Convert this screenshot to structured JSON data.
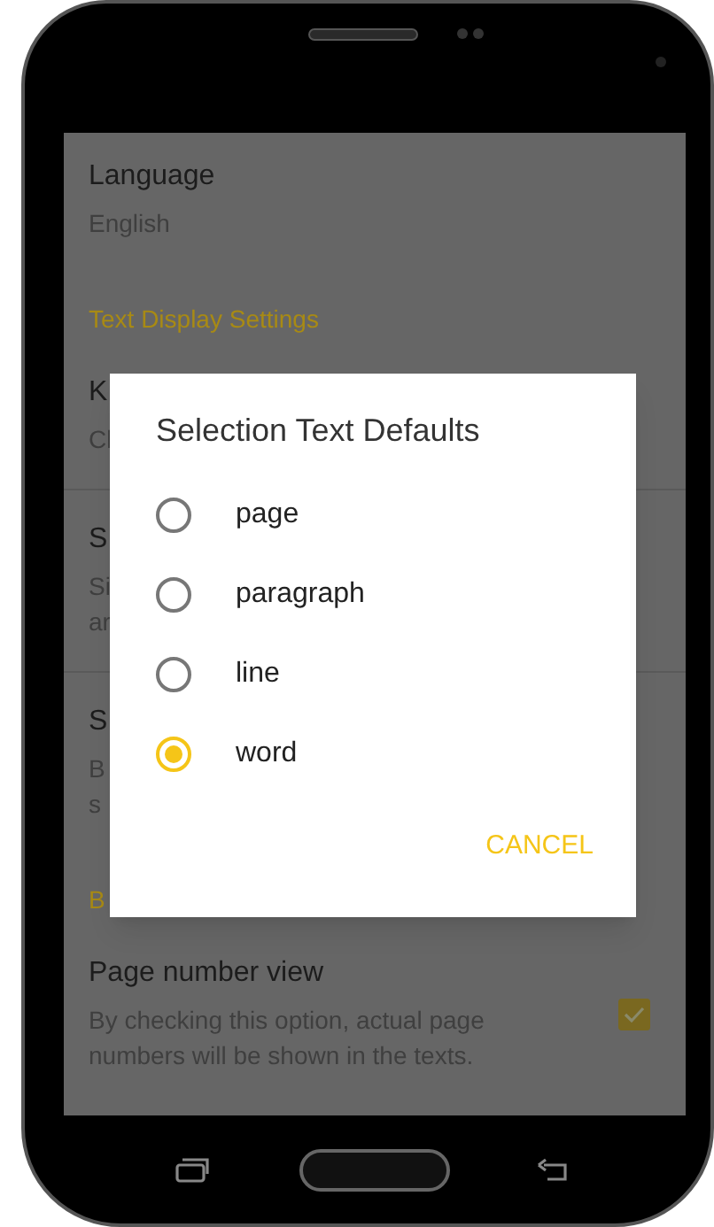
{
  "settings": [
    {
      "kind": "item",
      "title": "Language",
      "subtitle": [
        "English"
      ]
    },
    {
      "kind": "header",
      "title": "Text Display Settings"
    },
    {
      "kind": "item",
      "title": "K",
      "subtitle": [
        "Cl"
      ]
    },
    {
      "kind": "item",
      "title": "S",
      "subtitle": [
        "Si",
        "ar"
      ]
    },
    {
      "kind": "item",
      "title": "S",
      "subtitle": [
        "B",
        "s"
      ]
    },
    {
      "kind": "header",
      "title": "B"
    },
    {
      "kind": "check",
      "title": "Page number view",
      "subtitle": [
        "By checking this option, actual page",
        "numbers will be shown in the texts."
      ],
      "checked": true
    }
  ],
  "dialog": {
    "title": "Selection Text Defaults",
    "options": [
      {
        "label": "page",
        "selected": false
      },
      {
        "label": "paragraph",
        "selected": false
      },
      {
        "label": "line",
        "selected": false
      },
      {
        "label": "word",
        "selected": true
      }
    ],
    "cancel": "CANCEL"
  }
}
